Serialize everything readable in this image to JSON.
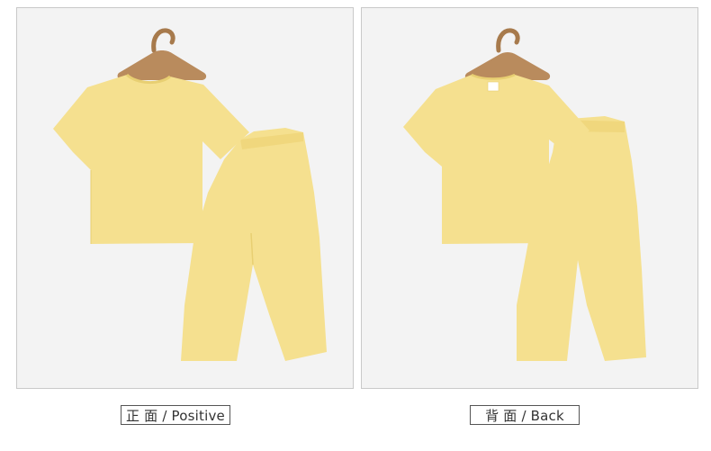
{
  "panels": [
    {
      "id": "front",
      "caption": "正 面 / Positive"
    },
    {
      "id": "back",
      "caption": "背 面 / Back"
    }
  ],
  "colors": {
    "background": "#f3f3f3",
    "garment": "#f5e08f",
    "garment_shadow": "#e8cf72",
    "hanger": "#b98b5d",
    "hanger_hook": "#a77a4c"
  }
}
